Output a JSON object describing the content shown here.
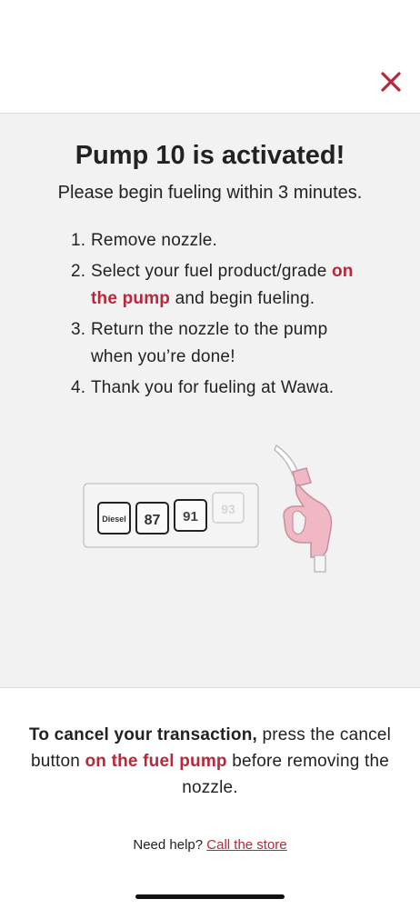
{
  "header": {
    "close_icon": "close-icon",
    "accent_color": "#b8283a"
  },
  "main": {
    "title": "Pump 10 is activated!",
    "subtitle": "Please begin fueling within 3 minutes.",
    "steps": [
      {
        "num": "1.",
        "text": "Remove nozzle."
      },
      {
        "num": "2.",
        "text_before": "Select your fuel product/grade",
        "highlight": "on the pump",
        "text_after": "and begin fueling."
      },
      {
        "num": "3.",
        "text": "Return the nozzle to the pump when you’re done!"
      },
      {
        "num": "4.",
        "text": "Thank you for fueling at Wawa."
      }
    ]
  },
  "illustration": {
    "grade_buttons": [
      "Diesel",
      "87",
      "91",
      "93"
    ],
    "nozzle_color": "#f0b7c4"
  },
  "footer": {
    "cancel_bold": "To cancel your transaction,",
    "cancel_mid": "press the cancel button",
    "cancel_highlight": "on the fuel pump",
    "cancel_end": "before removing the nozzle.",
    "help_prefix": "Need help?",
    "help_link": "Call the store"
  }
}
